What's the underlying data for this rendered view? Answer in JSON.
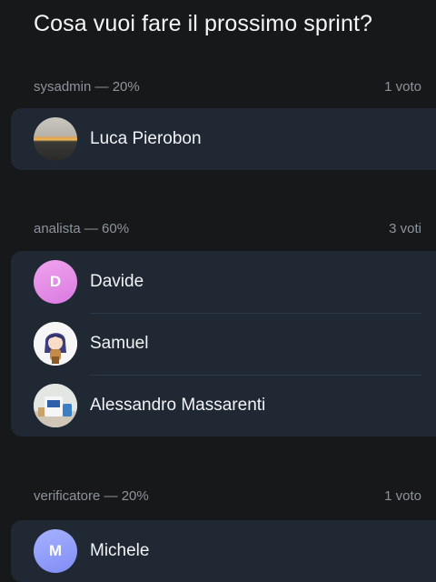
{
  "poll": {
    "question": "Cosa vuoi fare il prossimo sprint?",
    "options": [
      {
        "label": "sysadmin — 20%",
        "votes": "1 voto",
        "percent": 20,
        "voters": [
          {
            "name": "Luca Pierobon",
            "avatar": "sunset-photo"
          }
        ]
      },
      {
        "label": "analista — 60%",
        "votes": "3 voti",
        "percent": 60,
        "voters": [
          {
            "name": "Davide",
            "avatar": "letter",
            "initial": "D",
            "color": "#e690e8"
          },
          {
            "name": "Samuel",
            "avatar": "anime-character-photo"
          },
          {
            "name": "Alessandro Massarenti",
            "avatar": "objects-photo"
          }
        ]
      },
      {
        "label": "verificatore — 20%",
        "votes": "1 voto",
        "percent": 20,
        "voters": [
          {
            "name": "Michele",
            "avatar": "letter",
            "initial": "M",
            "color": "#95a2fb"
          }
        ]
      }
    ]
  },
  "colors": {
    "background": "#17181a",
    "card": "#1f2833",
    "muted_text": "#8e939b",
    "text": "#f2f3f5"
  }
}
